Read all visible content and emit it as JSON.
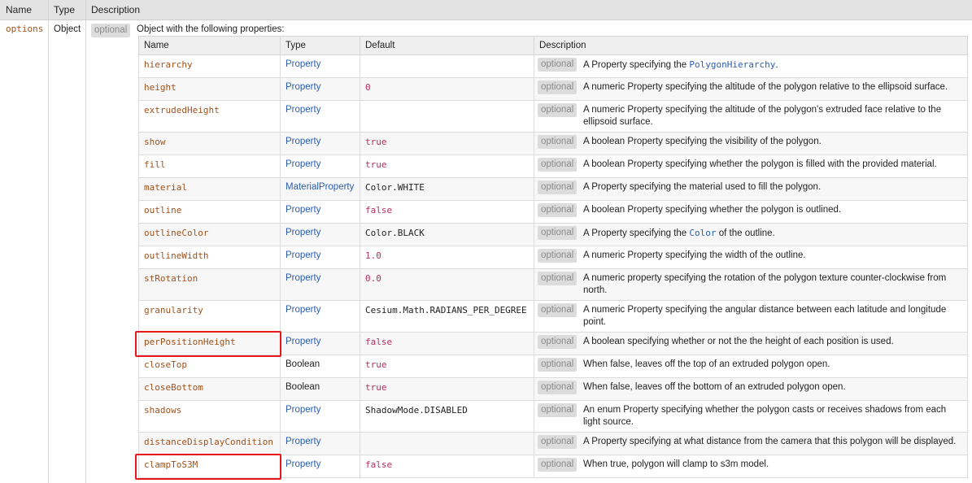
{
  "outer_headers": [
    "Name",
    "Type",
    "Description"
  ],
  "param": {
    "name": "options",
    "type": "Object",
    "badge": "optional",
    "description": "Object with the following properties:"
  },
  "inner_headers": [
    "Name",
    "Type",
    "Default",
    "Description"
  ],
  "optional_label": "optional",
  "rows": [
    {
      "name": "hierarchy",
      "type": "Property",
      "type_link": true,
      "default": "",
      "desc_before": "A Property specifying the ",
      "desc_link": "PolygonHierarchy",
      "desc_after": "."
    },
    {
      "name": "height",
      "type": "Property",
      "type_link": true,
      "default": "0",
      "default_style": "red",
      "desc_before": "A numeric Property specifying the altitude of the polygon relative to the ellipsoid surface.",
      "desc_link": "",
      "desc_after": ""
    },
    {
      "name": "extrudedHeight",
      "type": "Property",
      "type_link": true,
      "default": "",
      "desc_before": "A numeric Property specifying the altitude of the polygon's extruded face relative to the ellipsoid surface.",
      "desc_link": "",
      "desc_after": ""
    },
    {
      "name": "show",
      "type": "Property",
      "type_link": true,
      "default": "true",
      "default_style": "red",
      "desc_before": "A boolean Property specifying the visibility of the polygon.",
      "desc_link": "",
      "desc_after": ""
    },
    {
      "name": "fill",
      "type": "Property",
      "type_link": true,
      "default": "true",
      "default_style": "red",
      "desc_before": "A boolean Property specifying whether the polygon is filled with the provided material.",
      "desc_link": "",
      "desc_after": ""
    },
    {
      "name": "material",
      "type": "MaterialProperty",
      "type_link": true,
      "default": "Color.WHITE",
      "desc_before": "A Property specifying the material used to fill the polygon.",
      "desc_link": "",
      "desc_after": ""
    },
    {
      "name": "outline",
      "type": "Property",
      "type_link": true,
      "default": "false",
      "default_style": "red",
      "desc_before": "A boolean Property specifying whether the polygon is outlined.",
      "desc_link": "",
      "desc_after": ""
    },
    {
      "name": "outlineColor",
      "type": "Property",
      "type_link": true,
      "default": "Color.BLACK",
      "desc_before": "A Property specifying the ",
      "desc_link": "Color",
      "desc_after": " of the outline."
    },
    {
      "name": "outlineWidth",
      "type": "Property",
      "type_link": true,
      "default": "1.0",
      "default_style": "red",
      "desc_before": "A numeric Property specifying the width of the outline.",
      "desc_link": "",
      "desc_after": ""
    },
    {
      "name": "stRotation",
      "type": "Property",
      "type_link": true,
      "default": "0.0",
      "default_style": "red",
      "desc_before": "A numeric property specifying the rotation of the polygon texture counter-clockwise from north.",
      "desc_link": "",
      "desc_after": ""
    },
    {
      "name": "granularity",
      "type": "Property",
      "type_link": true,
      "default": "Cesium.Math.RADIANS_PER_DEGREE",
      "desc_before": "A numeric Property specifying the angular distance between each latitude and longitude point.",
      "desc_link": "",
      "desc_after": ""
    },
    {
      "name": "perPositionHeight",
      "type": "Property",
      "type_link": true,
      "default": "false",
      "default_style": "red",
      "desc_before": "A boolean specifying whether or not the the height of each position is used.",
      "desc_link": "",
      "desc_after": ""
    },
    {
      "name": "closeTop",
      "type": "Boolean",
      "type_link": false,
      "default": "true",
      "default_style": "red",
      "desc_before": "When false, leaves off the top of an extruded polygon open.",
      "desc_link": "",
      "desc_after": ""
    },
    {
      "name": "closeBottom",
      "type": "Boolean",
      "type_link": false,
      "default": "true",
      "default_style": "red",
      "desc_before": "When false, leaves off the bottom of an extruded polygon open.",
      "desc_link": "",
      "desc_after": ""
    },
    {
      "name": "shadows",
      "type": "Property",
      "type_link": true,
      "default": "ShadowMode.DISABLED",
      "desc_before": "An enum Property specifying whether the polygon casts or receives shadows from each light source.",
      "desc_link": "",
      "desc_after": ""
    },
    {
      "name": "distanceDisplayCondition",
      "type": "Property",
      "type_link": true,
      "default": "",
      "desc_before": "A Property specifying at what distance from the camera that this polygon will be displayed.",
      "desc_link": "",
      "desc_after": ""
    },
    {
      "name": "clampToS3M",
      "type": "Property",
      "type_link": true,
      "default": "false",
      "default_style": "red",
      "desc_before": "When true, polygon will clamp to s3m model.",
      "desc_link": "",
      "desc_after": ""
    }
  ],
  "highlighted_rows": [
    "perPositionHeight",
    "clampToS3M"
  ],
  "colors": {
    "name_text": "#a0521c",
    "link": "#2a5db0",
    "literal": "#b03060",
    "highlight_border": "#e8171b",
    "badge_bg": "#dcdcdc"
  }
}
